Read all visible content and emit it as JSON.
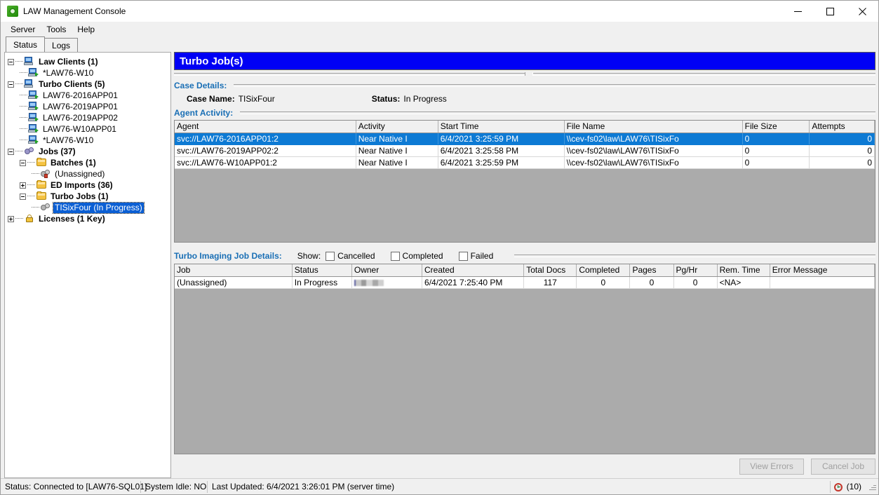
{
  "window": {
    "title": "LAW Management Console",
    "icon": "law-app-icon",
    "controls": {
      "minimize": "minimize-icon",
      "maximize": "maximize-icon",
      "close": "close-icon"
    }
  },
  "menubar": {
    "items": [
      {
        "label": "Server"
      },
      {
        "label": "Tools"
      },
      {
        "label": "Help"
      }
    ]
  },
  "tabs": [
    {
      "label": "Status",
      "accel": "S",
      "active": true
    },
    {
      "label": "Logs",
      "accel": "L",
      "active": false
    }
  ],
  "tree": {
    "nodes": [
      {
        "label": "Law Clients (1)",
        "depth": 0,
        "expander": "minus",
        "icon": "computer-icon",
        "bold": true,
        "selected": false
      },
      {
        "label": "*LAW76-W10",
        "depth": 1,
        "expander": "none",
        "icon": "computer-running-icon",
        "bold": false,
        "selected": false
      },
      {
        "label": "Turbo Clients (5)",
        "depth": 0,
        "expander": "minus",
        "icon": "computer-icon",
        "bold": true,
        "selected": false
      },
      {
        "label": "LAW76-2016APP01",
        "depth": 1,
        "expander": "none",
        "icon": "computer-running-icon",
        "bold": false,
        "selected": false
      },
      {
        "label": "LAW76-2019APP01",
        "depth": 1,
        "expander": "none",
        "icon": "computer-running-icon",
        "bold": false,
        "selected": false
      },
      {
        "label": "LAW76-2019APP02",
        "depth": 1,
        "expander": "none",
        "icon": "computer-running-icon",
        "bold": false,
        "selected": false
      },
      {
        "label": "LAW76-W10APP01",
        "depth": 1,
        "expander": "none",
        "icon": "computer-running-icon",
        "bold": false,
        "selected": false
      },
      {
        "label": "*LAW76-W10",
        "depth": 1,
        "expander": "none",
        "icon": "computer-running-icon",
        "bold": false,
        "selected": false
      },
      {
        "label": "Jobs (37)",
        "depth": 0,
        "expander": "minus",
        "icon": "gears-icon",
        "bold": true,
        "selected": false
      },
      {
        "label": "Batches (1)",
        "depth": 1,
        "expander": "minus",
        "icon": "folder-icon",
        "bold": true,
        "selected": false
      },
      {
        "label": "(Unassigned)",
        "depth": 2,
        "expander": "none",
        "icon": "gear-batch-icon",
        "bold": false,
        "selected": false
      },
      {
        "label": "ED Imports (36)",
        "depth": 1,
        "expander": "plus",
        "icon": "folder-icon",
        "bold": true,
        "selected": false
      },
      {
        "label": "Turbo Jobs (1)",
        "depth": 1,
        "expander": "minus",
        "icon": "folder-icon",
        "bold": true,
        "selected": false
      },
      {
        "label": "TISixFour (In Progress)",
        "depth": 2,
        "expander": "none",
        "icon": "gears-grey-icon",
        "bold": false,
        "selected": true
      },
      {
        "label": "Licenses (1 Key)",
        "depth": 0,
        "expander": "plus",
        "icon": "lock-icon",
        "bold": true,
        "selected": false
      }
    ]
  },
  "main": {
    "header": "Turbo Job(s)",
    "case_details": {
      "section_label": "Case Details:",
      "case_name_label": "Case Name:",
      "case_name_value": "TISixFour",
      "status_label": "Status:",
      "status_value": "In Progress"
    },
    "agent_activity": {
      "section_label": "Agent Activity:",
      "columns": [
        "Agent",
        "Activity",
        "Start Time",
        "File Name",
        "File Size",
        "Attempts"
      ],
      "rows": [
        {
          "selected": true,
          "cells": [
            "svc://LAW76-2016APP01:2",
            "Near Native I",
            "6/4/2021 3:25:59 PM",
            "\\\\cev-fs02\\law\\LAW76\\TISixFo",
            "0",
            "0"
          ]
        },
        {
          "selected": false,
          "cells": [
            "svc://LAW76-2019APP02:2",
            "Near Native I",
            "6/4/2021 3:25:58 PM",
            "\\\\cev-fs02\\law\\LAW76\\TISixFo",
            "0",
            "0"
          ]
        },
        {
          "selected": false,
          "cells": [
            "svc://LAW76-W10APP01:2",
            "Near Native I",
            "6/4/2021 3:25:59 PM",
            "\\\\cev-fs02\\law\\LAW76\\TISixFo",
            "0",
            "0"
          ]
        }
      ]
    },
    "job_details": {
      "section_label": "Turbo Imaging Job Details:",
      "show_label": "Show:",
      "filters": [
        {
          "label": "Cancelled",
          "checked": false
        },
        {
          "label": "Completed",
          "checked": false
        },
        {
          "label": "Failed",
          "checked": false
        }
      ],
      "columns": [
        "Job",
        "Status",
        "Owner",
        "Created",
        "Total Docs",
        "Completed",
        "Pages",
        "Pg/Hr",
        "Rem. Time",
        "Error Message"
      ],
      "rows": [
        {
          "job": "(Unassigned)",
          "status": "In Progress",
          "owner": "",
          "owner_redacted": true,
          "created": "6/4/2021 7:25:40 PM",
          "total_docs": "117",
          "completed": "0",
          "pages": "0",
          "pg_hr": "0",
          "rem_time": "<NA>",
          "error_message": ""
        }
      ]
    },
    "buttons": [
      {
        "label": "View Errors",
        "enabled": false
      },
      {
        "label": "Cancel Job",
        "enabled": false
      }
    ]
  },
  "statusbar": {
    "connection": "Status: Connected to [LAW76-SQL01]",
    "idle": "System Idle: NO",
    "last_updated": "Last Updated: 6/4/2021 3:26:01 PM (server time)",
    "clock_count": "(10)",
    "clock_icon": "alarm-clock-icon",
    "grip_icon": "resize-grip-icon"
  },
  "colors": {
    "accent_blue": "#0000F5",
    "section_label": "#1A6FB5",
    "selection": "#0D7AD4",
    "grid_empty": "#ABABAB",
    "chrome": "#F0F0F0"
  }
}
